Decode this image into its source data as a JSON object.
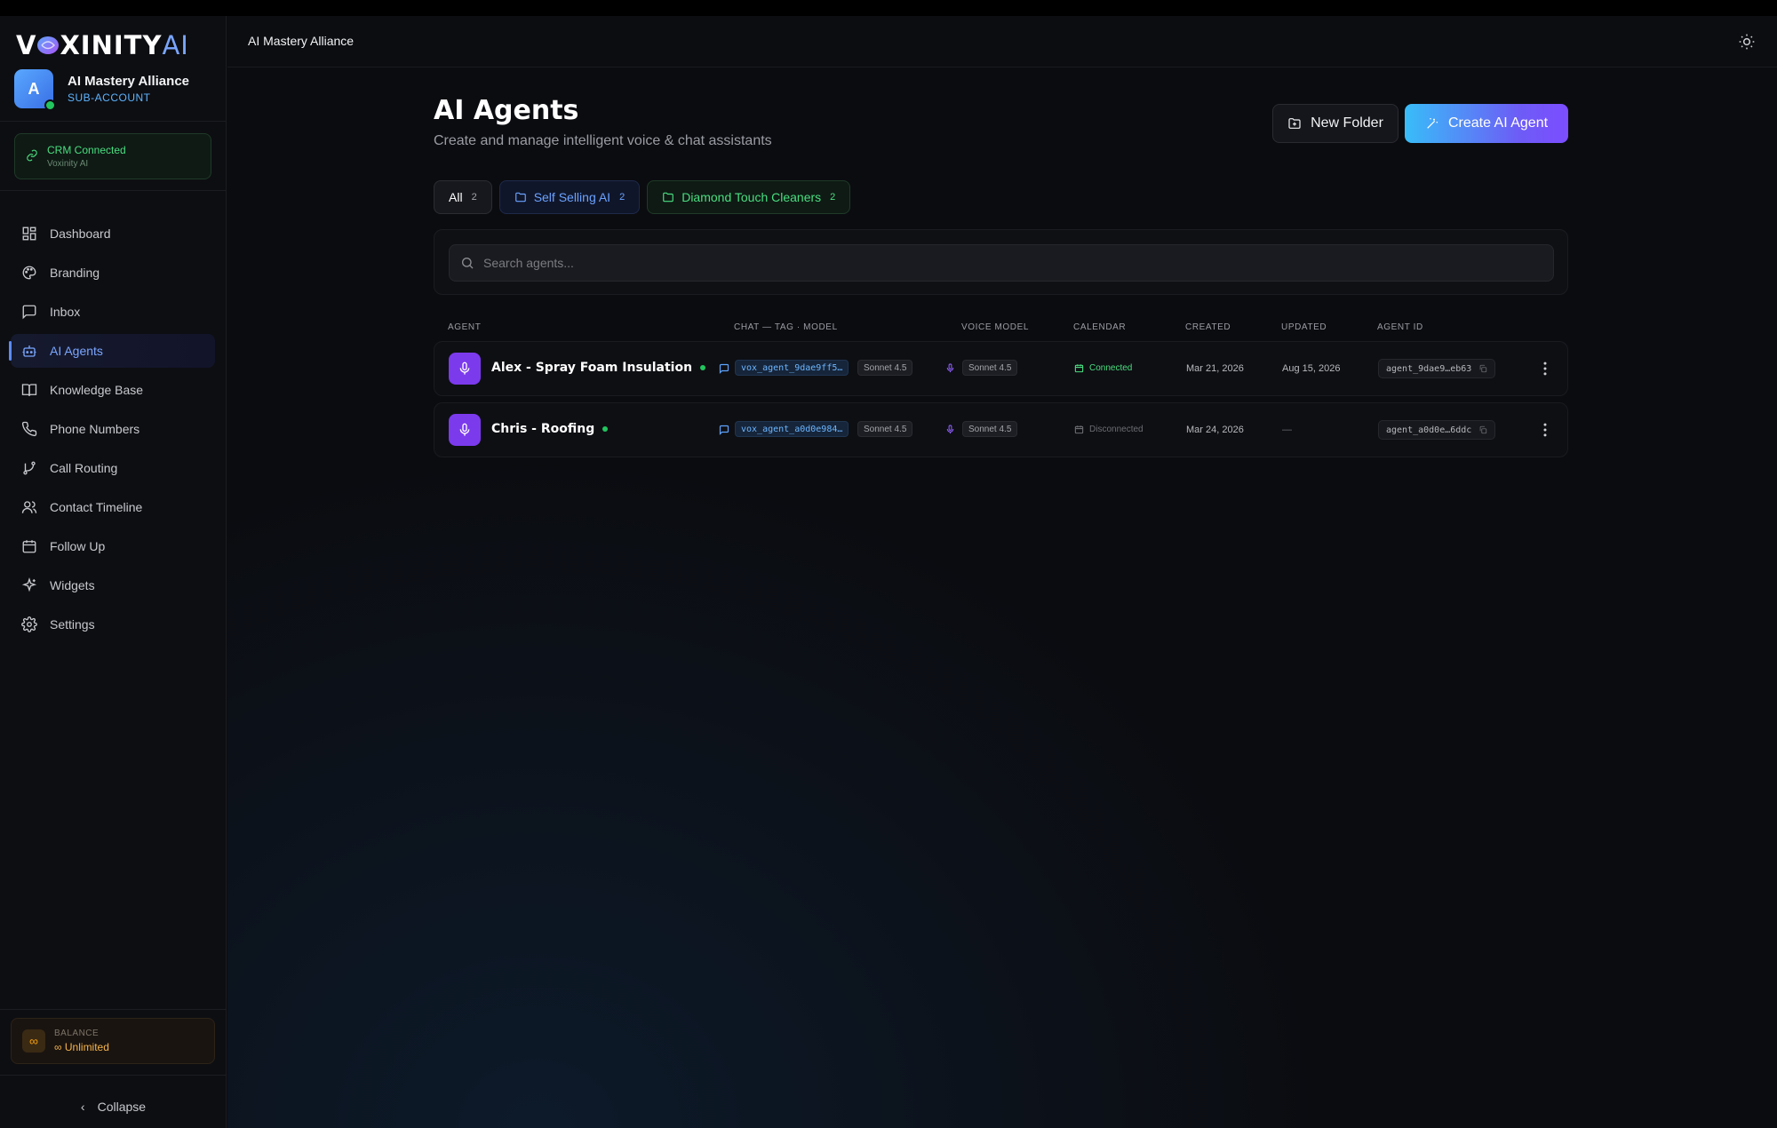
{
  "brand": {
    "logo_text_a": "V",
    "logo_text_b": "XINITY",
    "logo_text_ai": "AI"
  },
  "account": {
    "initial": "A",
    "name": "AI Mastery Alliance",
    "type": "SUB-ACCOUNT"
  },
  "crm": {
    "title": "CRM Connected",
    "subtitle": "Voxinity AI"
  },
  "sidebar": {
    "items": [
      {
        "label": "Dashboard"
      },
      {
        "label": "Branding"
      },
      {
        "label": "Inbox"
      },
      {
        "label": "AI Agents"
      },
      {
        "label": "Knowledge Base"
      },
      {
        "label": "Phone Numbers"
      },
      {
        "label": "Call Routing"
      },
      {
        "label": "Contact Timeline"
      },
      {
        "label": "Follow Up"
      },
      {
        "label": "Widgets"
      },
      {
        "label": "Settings"
      }
    ],
    "active": "AI Agents"
  },
  "balance": {
    "label": "BALANCE",
    "value": "Unlimited"
  },
  "collapse_label": "Collapse",
  "header": {
    "title": "AI Mastery Alliance"
  },
  "page": {
    "title": "AI Agents",
    "subtitle": "Create and manage intelligent voice & chat assistants",
    "new_folder": "New Folder",
    "create_agent": "Create AI Agent"
  },
  "filters": [
    {
      "label": "All",
      "count": "2"
    },
    {
      "label": "Self Selling AI",
      "count": "2"
    },
    {
      "label": "Diamond Touch Cleaners",
      "count": "2"
    }
  ],
  "search": {
    "placeholder": "Search agents..."
  },
  "table": {
    "headers": [
      "AGENT",
      "CHAT — TAG · MODEL",
      "VOICE MODEL",
      "CALENDAR",
      "CREATED",
      "UPDATED",
      "AGENT ID"
    ],
    "rows": [
      {
        "name": "Alex - Spray Foam Insulation",
        "chat_tag": "vox_agent_9dae9ff5…",
        "chat_model": "Sonnet 4.5",
        "voice_model": "Sonnet 4.5",
        "calendar": "Connected",
        "created": "Mar 21, 2026",
        "updated": "Aug 15, 2026",
        "agent_id": "agent_9dae9…eb63"
      },
      {
        "name": "Chris - Roofing",
        "chat_tag": "vox_agent_a0d0e984…",
        "chat_model": "Sonnet 4.5",
        "voice_model": "Sonnet 4.5",
        "calendar": "Disconnected",
        "created": "Mar 24, 2026",
        "updated": "—",
        "agent_id": "agent_a0d0e…6ddc"
      }
    ]
  },
  "colors": {
    "accent": "#5b8bff",
    "success": "#22c55e",
    "agent_icon": "#7c3aed",
    "warning": "#f59e0b"
  }
}
